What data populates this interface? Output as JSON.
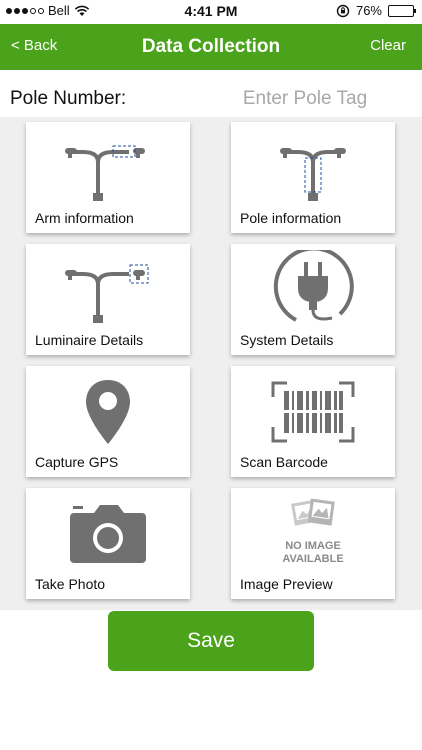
{
  "status_bar": {
    "carrier": "Bell",
    "time": "4:41 PM",
    "battery": "76%",
    "battery_fraction": 0.76
  },
  "nav": {
    "back_label": "< Back",
    "title": "Data Collection",
    "clear_label": "Clear",
    "color": "#4aa31a"
  },
  "pole": {
    "label": "Pole Number:",
    "value": "",
    "placeholder": "Enter Pole Tag"
  },
  "tiles": [
    {
      "label": "Arm information",
      "icon": "streetlight-arm-icon"
    },
    {
      "label": "Pole information",
      "icon": "streetlight-pole-icon"
    },
    {
      "label": "Luminaire Details",
      "icon": "streetlight-luminaire-icon"
    },
    {
      "label": "System Details",
      "icon": "power-plug-icon"
    },
    {
      "label": "Capture GPS",
      "icon": "map-pin-icon"
    },
    {
      "label": "Scan Barcode",
      "icon": "barcode-scan-icon"
    },
    {
      "label": "Take Photo",
      "icon": "camera-icon"
    },
    {
      "label": "Image Preview",
      "icon": "no-image-placeholder-icon",
      "placeholder_line1": "NO IMAGE",
      "placeholder_line2": "AVAILABLE"
    }
  ],
  "save_label": "Save",
  "colors": {
    "accent": "#4aa31a",
    "icon_gray": "#707070",
    "highlight_blue": "#1f4fa0"
  }
}
